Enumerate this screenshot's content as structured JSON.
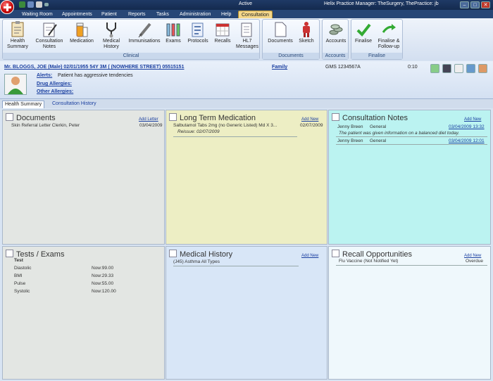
{
  "window": {
    "active_label": "Active",
    "title": "Helix Practice Manager: TheSurgery, ThePractice: jb"
  },
  "menu": {
    "tabs": [
      "Waiting Room",
      "Appointments",
      "Patient",
      "Reports",
      "Tasks",
      "Administration",
      "Help",
      "Consultation"
    ],
    "selected": "Consultation"
  },
  "ribbon": {
    "clinical": {
      "label": "Clinical",
      "buttons": [
        "Health Summary",
        "Consultation Notes",
        "Medication",
        "Medical History",
        "Immunisations",
        "Exams",
        "Protocols",
        "Recalls",
        "HL7 Messages"
      ]
    },
    "documents": {
      "label": "Documents",
      "buttons": [
        "Documents",
        "Sketch"
      ]
    },
    "accounts": {
      "label": "Accounts",
      "buttons": [
        "Accounts"
      ]
    },
    "finalise": {
      "label": "Finalise",
      "buttons": [
        "Finalise",
        "Finalise & Follow-up"
      ]
    }
  },
  "patient": {
    "name_line": "Mr. BLOGGS, JOE (Male) 02/01/1955 54Y 3M ( (NOWHERE STREET) 05515151",
    "family_link": "Family",
    "gms": "GMS 1234567A",
    "time": "0:10",
    "alerts_label": "Alerts:",
    "alerts_text": "Patient has aggressive tendencies",
    "drug_allergies": "Drug Allergies:",
    "other_allergies": "Other Allergies:"
  },
  "tabs": {
    "health_summary": "Health Summary",
    "consultation_history": "Consultation History"
  },
  "panels": {
    "documents": {
      "title": "Documents",
      "action": "Add Letter",
      "item": "Skin Referral Letter Clerkin, Peter",
      "date": "03/04/2009"
    },
    "medication": {
      "title": "Long Term Medication",
      "action": "Add New",
      "item": "Salbutamol Tabs 2mg (no Generic Listed) Md X 3...",
      "date": "02/07/2009",
      "reissue": "Reissue: 02/07/2009"
    },
    "consultation": {
      "title": "Consultation Notes",
      "action": "Add New",
      "entries": [
        {
          "author": "Jenny Breen",
          "type": "General",
          "when": "03/04/2009 13:32",
          "note": "The patient was given information on a balanced diet today."
        },
        {
          "author": "Jenny Breen",
          "type": "General",
          "when": "03/04/2009 12:01"
        }
      ]
    },
    "tests": {
      "title": "Tests / Exams",
      "column": "Test",
      "rows": [
        {
          "name": "Diastolic",
          "value": "Now:99.00"
        },
        {
          "name": "BMI",
          "value": "Now:29.33"
        },
        {
          "name": "Pulse",
          "value": "Now:55.00"
        },
        {
          "name": "Systolic",
          "value": "Now:120.00"
        }
      ]
    },
    "history": {
      "title": "Medical History",
      "action": "Add New",
      "item": "(J45) Asthma All Types"
    },
    "recall": {
      "title": "Recall Opportunities",
      "action": "Add New",
      "item": "Flu Vaccine (Not Notified Yet)",
      "status": "Overdue"
    }
  }
}
